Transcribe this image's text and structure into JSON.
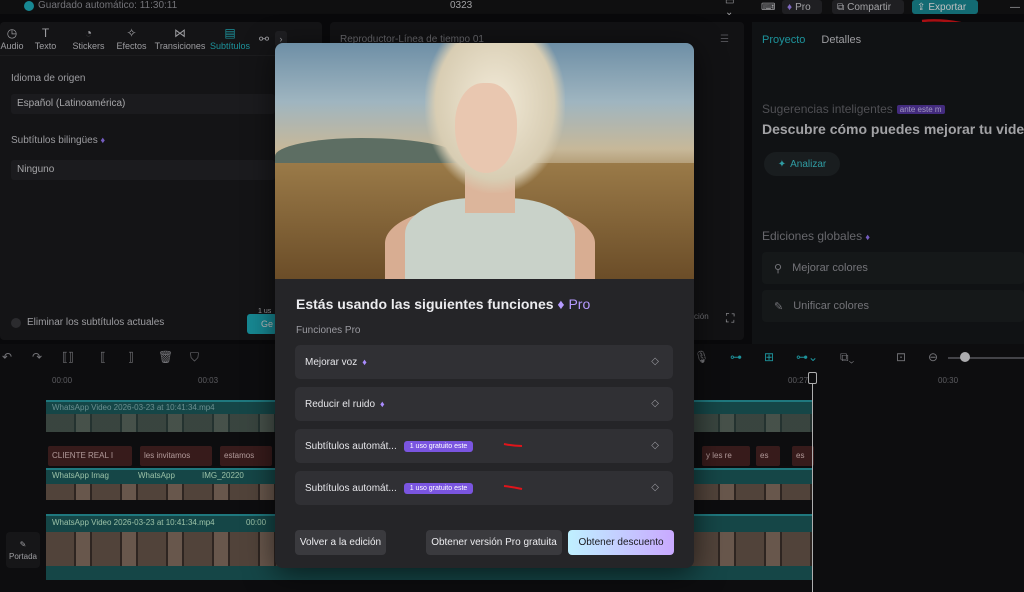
{
  "topbar": {
    "autosave": "Guardado automático: 11:30:11",
    "project_name": "0323",
    "pro_label": "Pro",
    "share_label": "Compartir",
    "export_label": "Exportar"
  },
  "left_panel": {
    "tabs": [
      {
        "label": "Audio",
        "icon": "audio-icon"
      },
      {
        "label": "Texto",
        "icon": "text-icon"
      },
      {
        "label": "Stickers",
        "icon": "sticker-icon"
      },
      {
        "label": "Efectos",
        "icon": "effects-icon"
      },
      {
        "label": "Transiciones",
        "icon": "transitions-icon"
      },
      {
        "label": "Subtítulos",
        "icon": "subtitles-icon"
      }
    ],
    "source_language_label": "Idioma de origen",
    "source_language_value": "Español (Latinoamérica)",
    "bilingual_label": "Subtítulos bilingües",
    "bilingual_value": "Ninguno",
    "remove_current_label": "Eliminar los subtítulos actuales",
    "generate_label": "Ge",
    "generate_tag": "1 us"
  },
  "player": {
    "title": "Reproductor-Línea de tiempo 01",
    "ratio_label": "ción"
  },
  "right_panel": {
    "tab_project": "Proyecto",
    "tab_details": "Detalles",
    "suggestions_label": "Sugerencias inteligentes",
    "suggestions_badge": "ante este m",
    "suggestions_desc": "Descubre cómo puedes mejorar tu video",
    "analyze_label": "Analizar",
    "global_edits_label": "Ediciones globales",
    "item_improve_colors": "Mejorar colores",
    "item_unify_colors": "Unificar colores"
  },
  "timeline": {
    "ruler": [
      "00:00",
      "00:03",
      "00:27",
      "00:30"
    ],
    "clip_top_label": "WhatsApp Video 2026-03-23 at 10:41:34.mp4",
    "clip_bottom_label": "WhatsApp Video 2026-03-23 at 10:41:34.mp4",
    "clip_bottom_time": "00:00",
    "captions": [
      "CLIENTE REAL I",
      "les invitamos",
      "estamos",
      "y les re",
      "es",
      "es"
    ],
    "small_clips": [
      "WhatsApp Imag",
      "WhatsApp",
      "IMG_20220"
    ],
    "cover_label": "Portada"
  },
  "modal": {
    "title": "Estás usando las siguientes funciones",
    "title_pro": "Pro",
    "section_label": "Funciones Pro",
    "features": [
      {
        "label": "Mejorar voz",
        "free_badge": ""
      },
      {
        "label": "Reducir el ruido",
        "free_badge": ""
      },
      {
        "label": "Subtítulos automát...",
        "free_badge": "1 uso gratuito este"
      },
      {
        "label": "Subtítulos automát...",
        "free_badge": "1 uso gratuito este"
      }
    ],
    "back_button": "Volver a la edición",
    "free_pro_button": "Obtener versión Pro gratuita",
    "discount_button": "Obtener descuento"
  },
  "colors": {
    "accent": "#27c3cf",
    "export": "#1a8f9a",
    "pro_purple": "#b69bff",
    "annotation_red": "#e0141a"
  }
}
